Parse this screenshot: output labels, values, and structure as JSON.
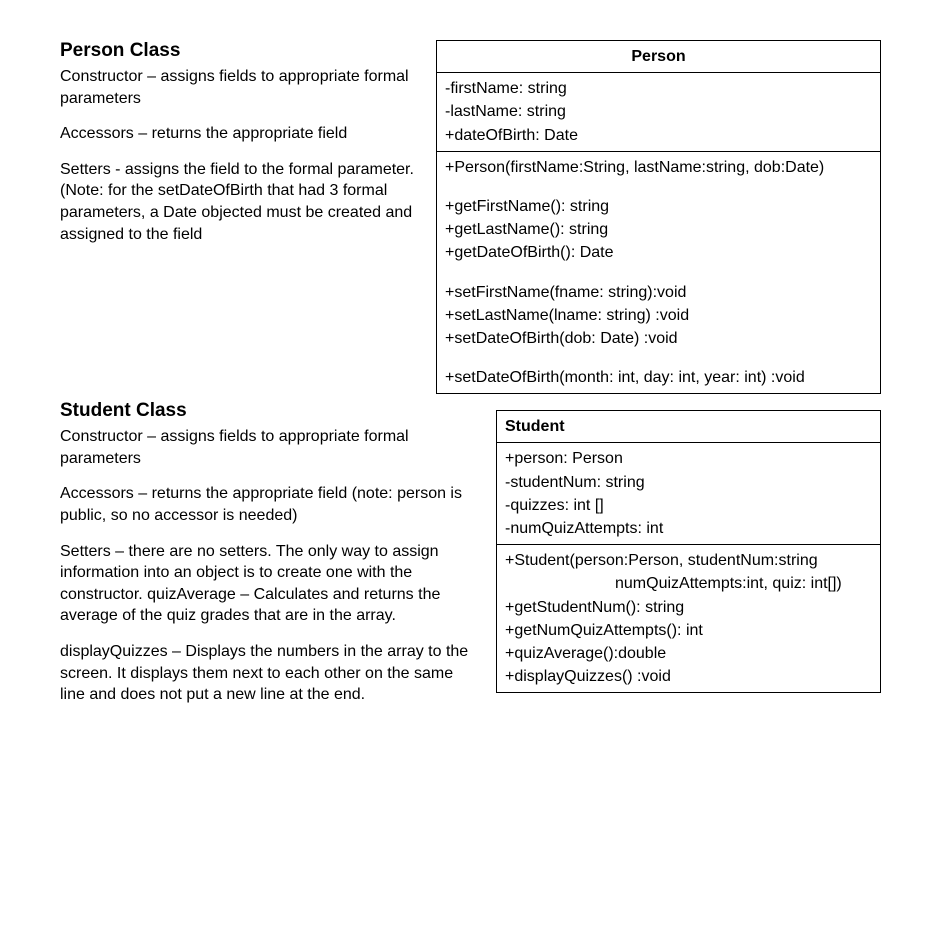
{
  "person": {
    "heading": "Person Class",
    "p1": "Constructor – assigns fields to appropriate formal parameters",
    "p2": "Accessors – returns the appropriate field",
    "p3": "Setters - assigns the field to the formal parameter. (Note: for the setDateOfBirth that had 3 formal parameters, a Date objected must be created and assigned to the field"
  },
  "student": {
    "heading": "Student Class",
    "p1": "Constructor – assigns fields to appropriate formal parameters",
    "p2": "Accessors – returns the appropriate field (note: person is public, so no accessor is needed)",
    "p3": "Setters – there are no setters. The only way to assign information into an object is to create one with the constructor. quizAverage – Calculates and returns the average of the quiz grades that are in the array.",
    "p4": "displayQuizzes – Displays the numbers in the array to the screen. It displays them next to each other on the same line and does not put a new line at the end."
  },
  "uml_person": {
    "title": "Person",
    "attr1": "-firstName: string",
    "attr2": "-lastName: string",
    "attr3": "+dateOfBirth: Date",
    "m1": "+Person(firstName:String, lastName:string, dob:Date)",
    "m2": "+getFirstName(): string",
    "m3": "+getLastName(): string",
    "m4": "+getDateOfBirth(): Date",
    "m5": "+setFirstName(fname: string):void",
    "m6": "+setLastName(lname: string) :void",
    "m7": "+setDateOfBirth(dob: Date) :void",
    "m8": "+setDateOfBirth(month: int, day: int, year: int) :void"
  },
  "uml_student": {
    "title": "Student",
    "attr1": "+person: Person",
    "attr2": "-studentNum: string",
    "attr3": "-quizzes: int []",
    "attr4": "-numQuizAttempts: int",
    "m1a": "+Student(person:Person, studentNum:string",
    "m1b": "numQuizAttempts:int, quiz: int[])",
    "m2": "+getStudentNum(): string",
    "m3": "+getNumQuizAttempts(): int",
    "m4": "+quizAverage():double",
    "m5": "+displayQuizzes() :void"
  }
}
